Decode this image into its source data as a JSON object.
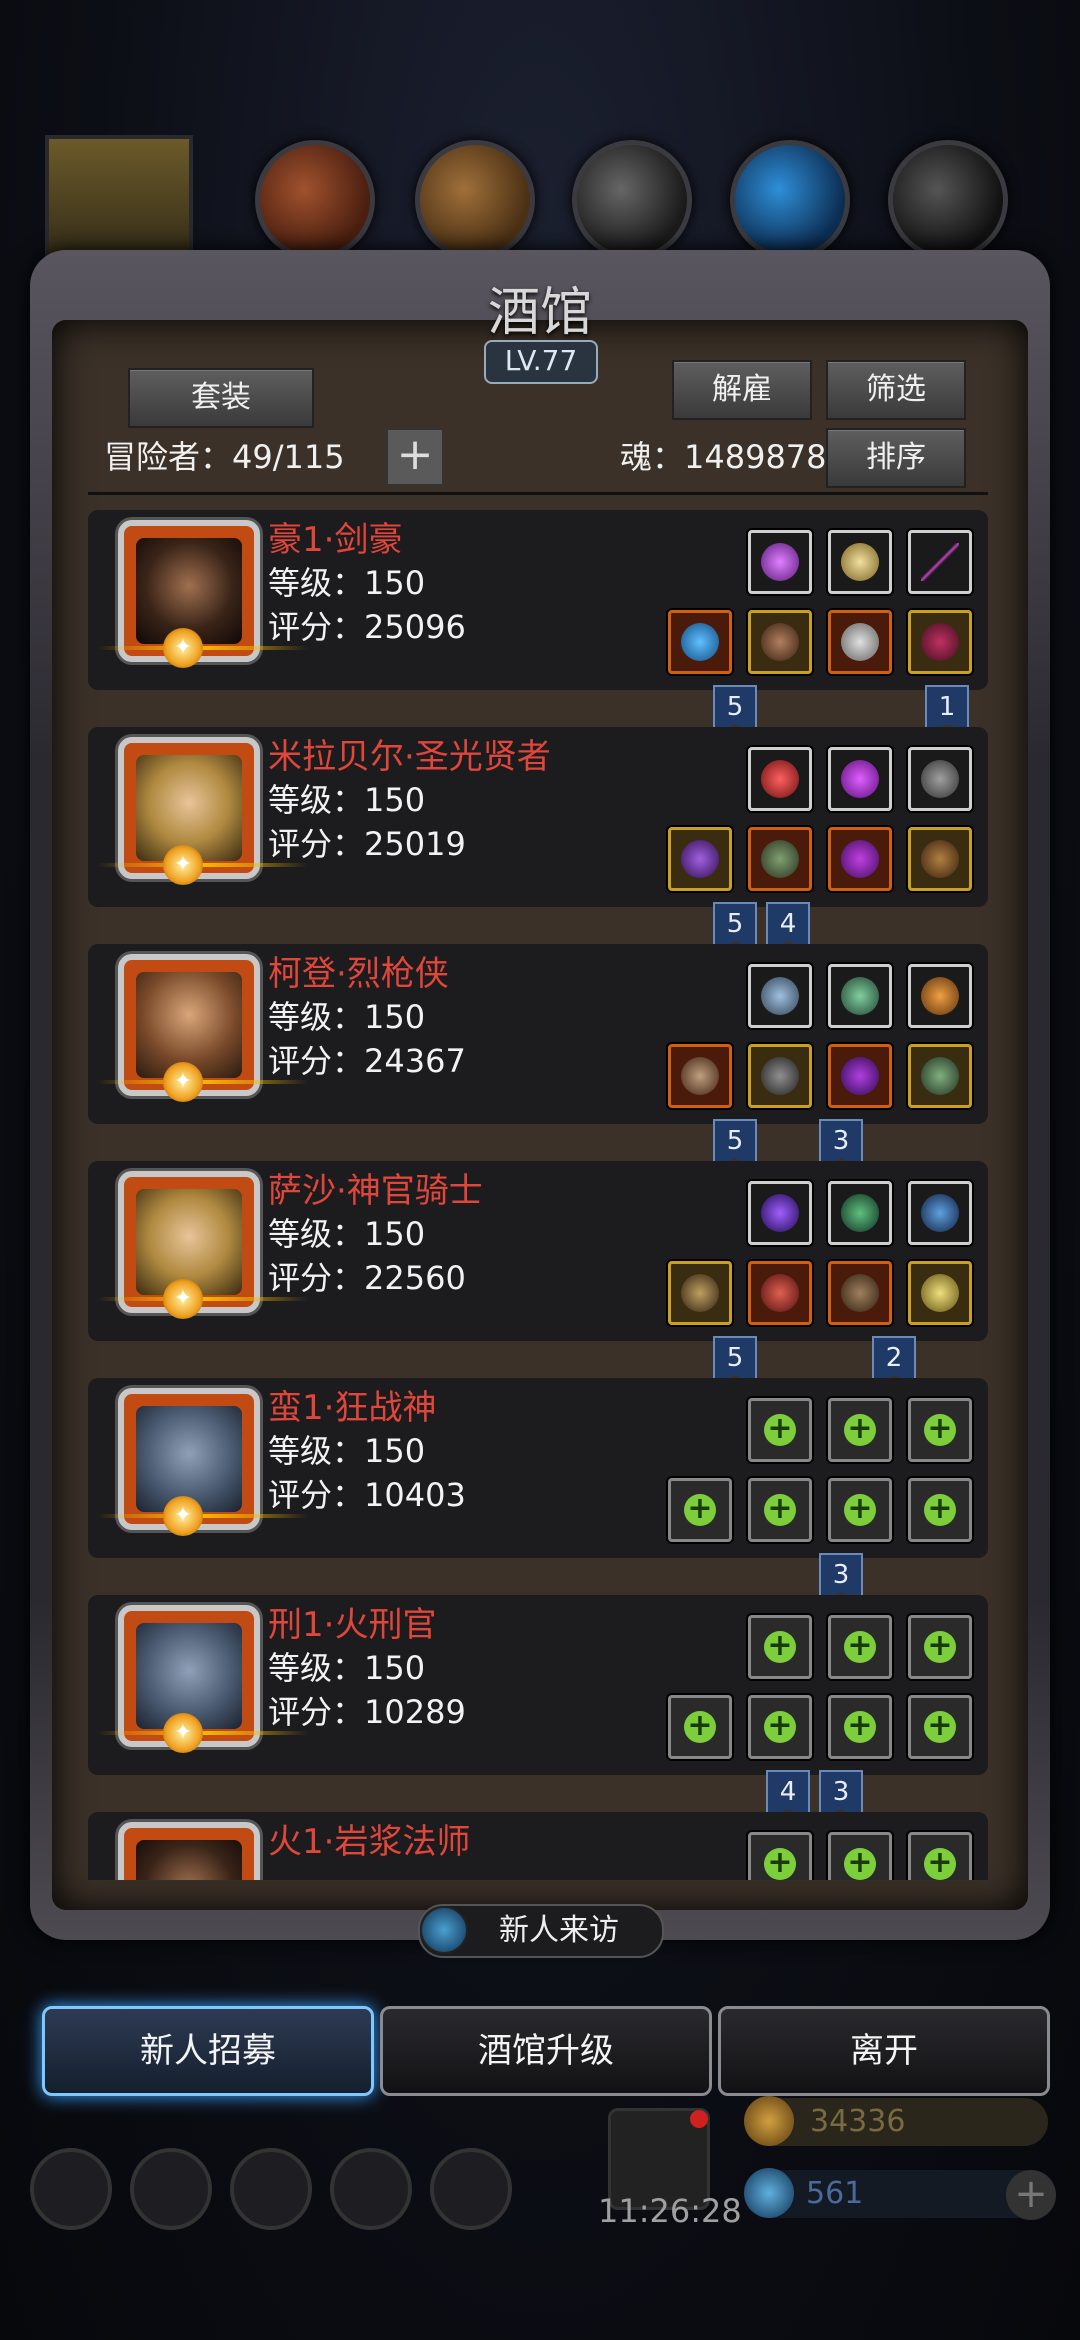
{
  "title": "酒馆",
  "level": "LV.77",
  "buttons": {
    "set": "套装",
    "dismiss": "解雇",
    "filter": "筛选",
    "sort": "排序",
    "recruit": "新人招募",
    "upgrade": "酒馆升级",
    "leave": "离开",
    "visitor": "新人来访"
  },
  "adventurer_label": "冒险者：49/115",
  "soul_label": "魂：1489878",
  "heroes": [
    {
      "name": "豪1·剑豪",
      "level": "等级：150",
      "score": "评分：25096",
      "tags": [
        {
          "v": "5",
          "col": 0
        },
        {
          "v": "1",
          "col": 3
        }
      ]
    },
    {
      "name": "米拉贝尔·圣光贤者",
      "level": "等级：150",
      "score": "评分：25019",
      "tags": [
        {
          "v": "5",
          "col": 0
        },
        {
          "v": "4",
          "col": 1
        }
      ]
    },
    {
      "name": "柯登·烈枪侠",
      "level": "等级：150",
      "score": "评分：24367",
      "tags": [
        {
          "v": "5",
          "col": 0
        },
        {
          "v": "3",
          "col": 2
        }
      ]
    },
    {
      "name": "萨沙·神官骑士",
      "level": "等级：150",
      "score": "评分：22560",
      "tags": [
        {
          "v": "5",
          "col": 0
        },
        {
          "v": "2",
          "col": 3
        }
      ]
    },
    {
      "name": "蛮1·狂战神",
      "level": "等级：150",
      "score": "评分：10403",
      "tags": [
        {
          "v": "3",
          "col": 2
        }
      ]
    },
    {
      "name": "刑1·火刑官",
      "level": "等级：150",
      "score": "评分：10289",
      "tags": [
        {
          "v": "4",
          "col": 1
        },
        {
          "v": "3",
          "col": 2
        }
      ]
    },
    {
      "name": "火1·岩浆法师",
      "level": "",
      "score": "",
      "tags": []
    }
  ],
  "footer": {
    "time": "11:26:28",
    "gold": "34336",
    "gems": "561"
  }
}
